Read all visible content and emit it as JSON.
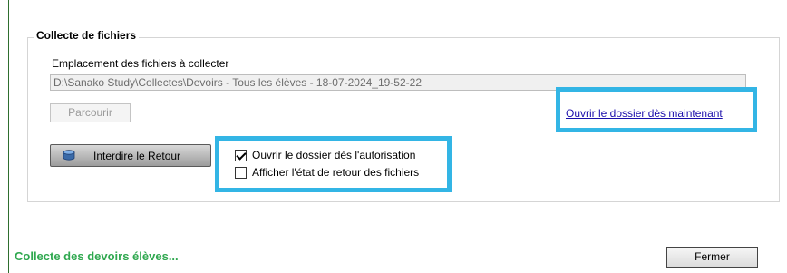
{
  "group": {
    "title": "Collecte de fichiers"
  },
  "location": {
    "label": "Emplacement des fichiers à collecter",
    "path_value": "D:\\Sanako Study\\Collectes\\Devoirs - Tous les élèves - 18-07-2024_19-52-22"
  },
  "buttons": {
    "browse": "Parcourir",
    "deny_return": "Interdire le Retour",
    "close": "Fermer"
  },
  "link": {
    "open_now": "Ouvrir le dossier dès maintenant"
  },
  "options": [
    {
      "label": "Ouvrir le dossier dès l'autorisation",
      "checked": true
    },
    {
      "label": "Afficher l'état de retour des fichiers",
      "checked": false
    }
  ],
  "status": {
    "text": "Collecte des devoirs élèves..."
  },
  "colors": {
    "highlight": "#33b5e5",
    "status": "#2fa84f",
    "link": "#1a0dab"
  },
  "icons": {
    "deny_button": "database-icon"
  }
}
